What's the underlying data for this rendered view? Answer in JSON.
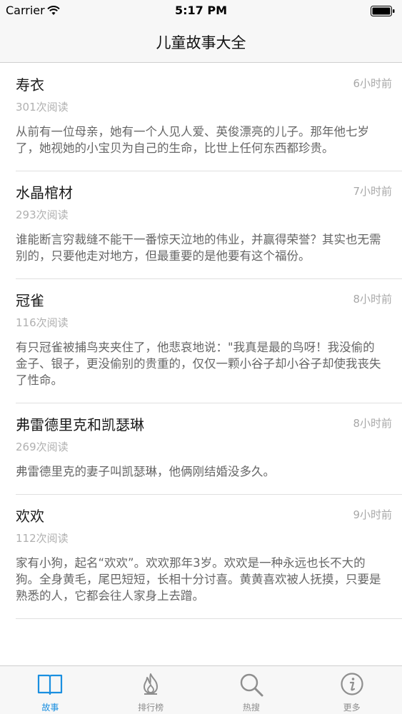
{
  "status_bar": {
    "carrier": "Carrier",
    "time": "5:17 PM"
  },
  "nav": {
    "title": "儿童故事大全"
  },
  "stories": [
    {
      "title": "寿衣",
      "time": "6小时前",
      "reads": "301次阅读",
      "excerpt": "从前有一位母亲，她有一个人见人爱、英俊漂亮的儿子。那年他七岁了，她视她的小宝贝为自己的生命，比世上任何东西都珍贵。"
    },
    {
      "title": "水晶棺材",
      "time": "7小时前",
      "reads": "293次阅读",
      "excerpt": "谁能断言穷裁缝不能干一番惊天泣地的伟业，并赢得荣誉？其实也无需别的，只要他走对地方，但最重要的是他要有这个福份。"
    },
    {
      "title": "冠雀",
      "time": "8小时前",
      "reads": "116次阅读",
      "excerpt": "有只冠雀被捕鸟夹夹住了，他悲哀地说：\"我真是最的鸟呀！我没偷的金子、银子，更没偷别的贵重的，仅仅一颗小谷子却小谷子却使我丧失了性命。"
    },
    {
      "title": "弗雷德里克和凯瑟琳",
      "time": "8小时前",
      "reads": "269次阅读",
      "excerpt": "弗雷德里克的妻子叫凯瑟琳，他俩刚结婚没多久。"
    },
    {
      "title": "欢欢",
      "time": "9小时前",
      "reads": "112次阅读",
      "excerpt": "家有小狗，起名“欢欢”。欢欢那年3岁。欢欢是一种永远也长不大的狗。全身黄毛，尾巴短短，长相十分讨喜。黄黄喜欢被人抚摸，只要是熟悉的人，它都会往人家身上去蹭。"
    }
  ],
  "tabs": [
    {
      "label": "故事",
      "icon": "book-icon",
      "active": true
    },
    {
      "label": "排行榜",
      "icon": "flame-icon",
      "active": false
    },
    {
      "label": "热搜",
      "icon": "search-icon",
      "active": false
    },
    {
      "label": "更多",
      "icon": "info-icon",
      "active": false
    }
  ],
  "colors": {
    "accent": "#1a8fe0",
    "inactive": "#8e8e8e"
  }
}
